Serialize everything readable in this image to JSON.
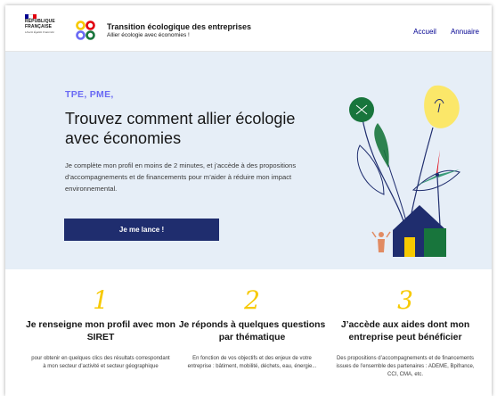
{
  "header": {
    "gov_name_line1": "RÉPUBLIQUE",
    "gov_name_line2": "FRANÇAISE",
    "gov_motto": "Liberté Égalité Fraternité",
    "site_title": "Transition écologique des entreprises",
    "site_subtitle": "Allier écologie avec économies !",
    "nav": [
      {
        "label": "Accueil"
      },
      {
        "label": "Annuaire"
      }
    ],
    "flag_colors": [
      "#000091",
      "#ffffff",
      "#e1000f"
    ],
    "logo_colors": [
      "#f7c900",
      "#e1000f",
      "#6a6af4",
      "#18753c"
    ]
  },
  "hero": {
    "kicker": "TPE, PME,",
    "title": "Trouvez comment allier écologie avec économies",
    "text": "Je complète mon profil en moins de 2 minutes, et j’accède à des propositions d’accompagnements et de financements pour m’aider à réduire mon impact environnemental.",
    "cta_label": "Je me lance !",
    "illustration": "plant-house-wind-turbine-illustration"
  },
  "steps": [
    {
      "number": "1",
      "title": "Je renseigne mon profil avec mon SIRET",
      "text": "pour obtenir en quelques clics des résultats correspondant à mon secteur d’activité et secteur géographique"
    },
    {
      "number": "2",
      "title": "Je réponds à quelques questions par thématique",
      "text": "En fonction de vos objectifs et des enjeux de votre entreprise : bâtiment, mobilité, déchets, eau, énergie..."
    },
    {
      "number": "3",
      "title": "J’accède aux aides dont mon entreprise peut bénéficier",
      "text": "Des propositions d’accompagnements et de financements issues de l’ensemble des partenaires : ADEME, Bpifrance, CCI, CMA, etc."
    }
  ]
}
